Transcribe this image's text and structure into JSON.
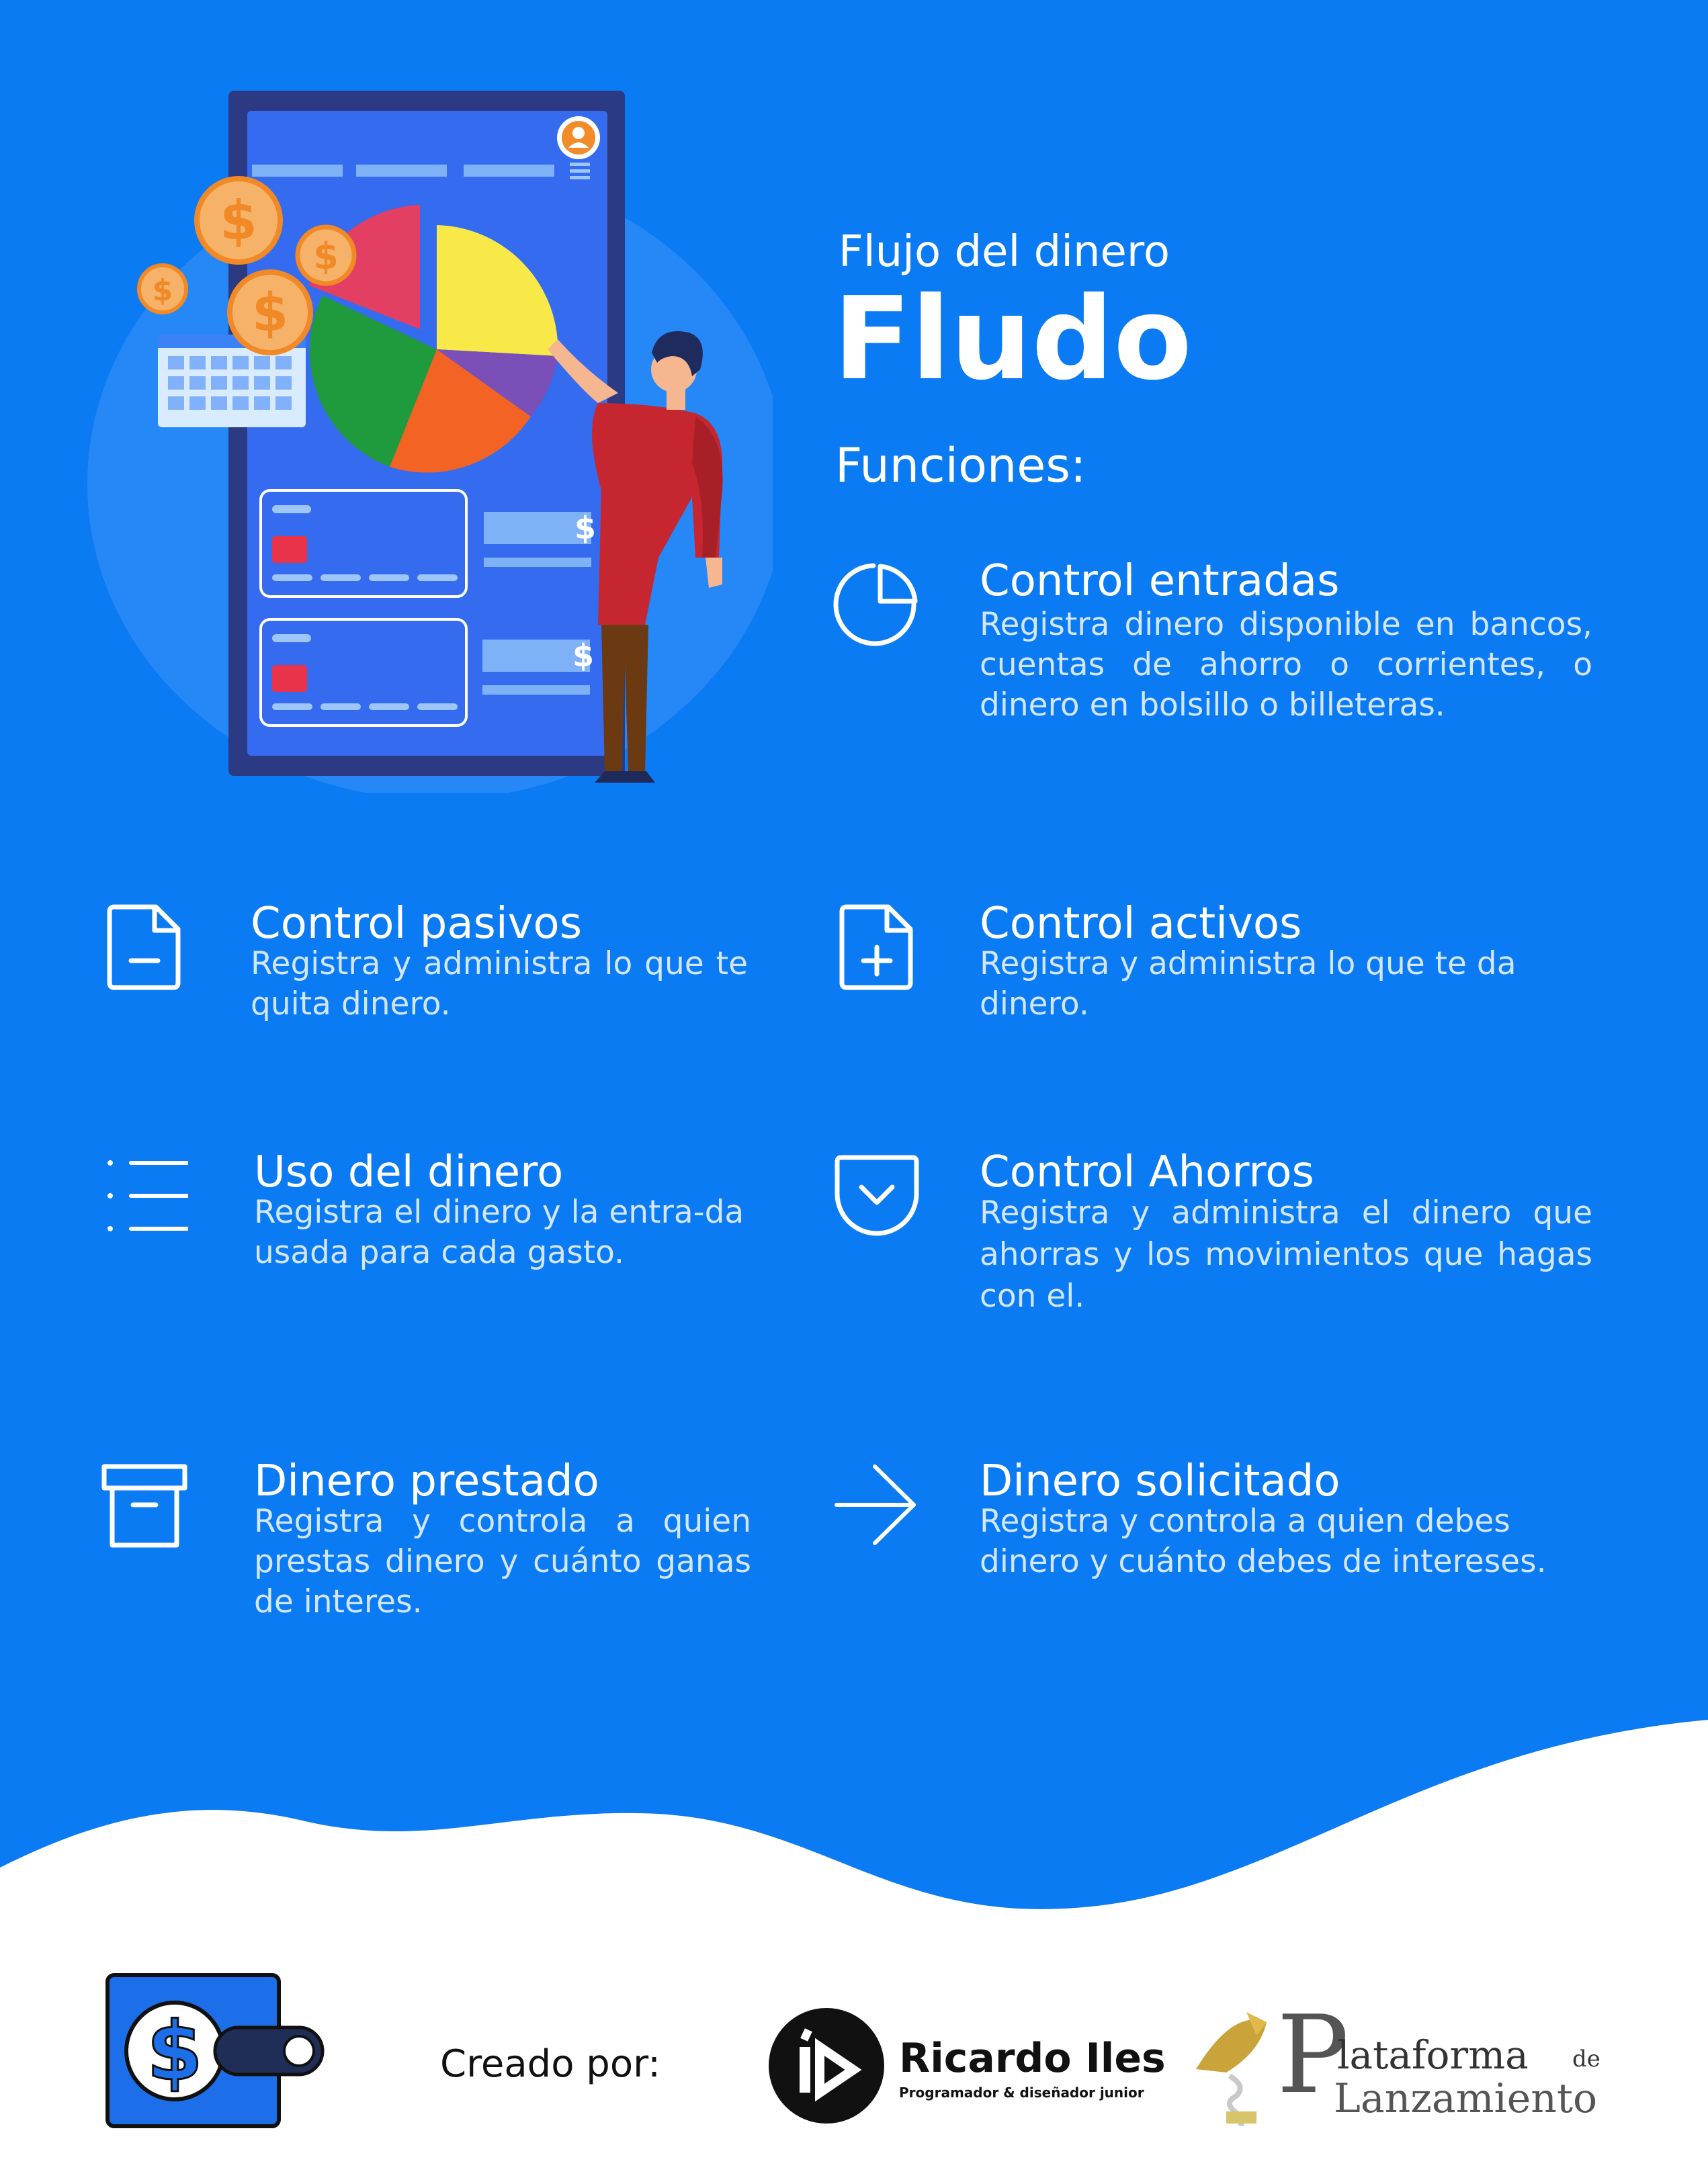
{
  "header": {
    "subtitle": "Flujo del dinero",
    "title": "Fludo",
    "section_label": "Funciones:"
  },
  "features": {
    "control_entradas": {
      "icon": "pie-chart-icon",
      "title": "Control entradas",
      "desc": "Registra dinero disponible en bancos, cuentas de ahorro o corrientes, o dinero en bolsillo o billeteras."
    },
    "control_pasivos": {
      "icon": "file-minus-icon",
      "title": "Control pasivos",
      "desc": "Registra y administra lo que te quita dinero."
    },
    "control_activos": {
      "icon": "file-plus-icon",
      "title": "Control activos",
      "desc": "Registra y administra lo que te da dinero."
    },
    "uso_dinero": {
      "icon": "list-icon",
      "title": "Uso del dinero",
      "desc": "Registra el dinero y la entra-da usada para cada gasto."
    },
    "control_ahorros": {
      "icon": "pocket-icon",
      "title": "Control Ahorros",
      "desc": "Registra y administra el dinero que ahorras y los movimientos que hagas con el."
    },
    "dinero_prestado": {
      "icon": "archive-icon",
      "title": "Dinero prestado",
      "desc": "Registra y controla a quien prestas dinero y cuánto ganas de interes."
    },
    "dinero_solicitado": {
      "icon": "arrow-right-icon",
      "title": "Dinero solicitado",
      "desc": "Registra y controla a quien debes dinero y cuánto debes de intereses."
    }
  },
  "footer": {
    "created_by": "Creado por:",
    "author_name": "Ricardo Iles",
    "author_role": "Programador & diseñador junior",
    "org_line1": "lataforma",
    "org_de": "de",
    "org_line2": "Lanzamiento",
    "org_initial": "P"
  },
  "colors": {
    "background": "#0b7bf3",
    "footer_bg": "#ffffff",
    "text": "#ffffff",
    "desc_text": "#d2e6ff"
  }
}
